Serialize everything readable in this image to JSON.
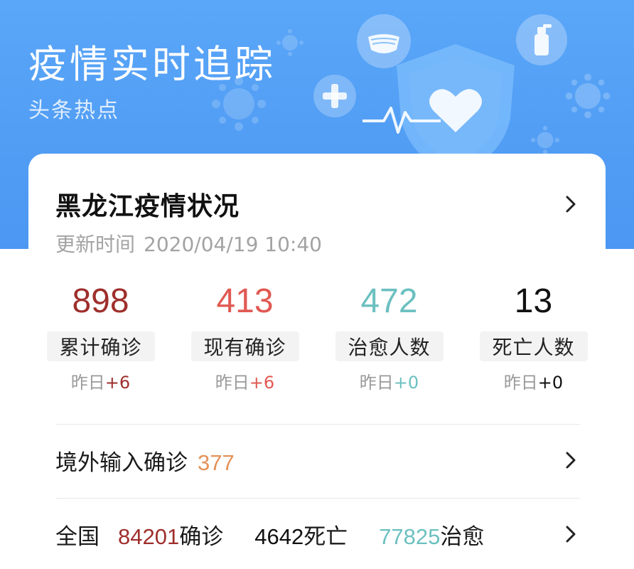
{
  "banner": {
    "title": "疫情实时追踪",
    "subtitle": "头条热点",
    "icons": [
      "virus-icon",
      "mask-icon",
      "spray-bottle-icon",
      "plus-icon",
      "shield-heart-icon",
      "heartbeat-line-icon"
    ]
  },
  "card": {
    "title": "黑龙江疫情状况",
    "updated_label": "更新时间",
    "updated_value": "2020/04/19 10:40",
    "stats": [
      {
        "value": "898",
        "label": "累计确诊",
        "delta_label": "昨日",
        "delta": "+6",
        "color": "#9e2f2c"
      },
      {
        "value": "413",
        "label": "现有确诊",
        "delta_label": "昨日",
        "delta": "+6",
        "color": "#e05a53"
      },
      {
        "value": "472",
        "label": "治愈人数",
        "delta_label": "昨日",
        "delta": "+0",
        "color": "#6cc0c0"
      },
      {
        "value": "13",
        "label": "死亡人数",
        "delta_label": "昨日",
        "delta": "+0",
        "color": "#111111"
      }
    ],
    "imported": {
      "label": "境外输入确诊",
      "value": "377"
    },
    "national": {
      "label": "全国",
      "confirmed_value": "84201",
      "confirmed_label": "确诊",
      "deaths_value": "4642",
      "deaths_label": "死亡",
      "recovered_value": "77825",
      "recovered_label": "治愈"
    }
  },
  "colors": {
    "banner": "#5aa6f8",
    "cumulative": "#9e2f2c",
    "current": "#e05a53",
    "recovered": "#6cc0c0",
    "imported": "#e3935a"
  }
}
